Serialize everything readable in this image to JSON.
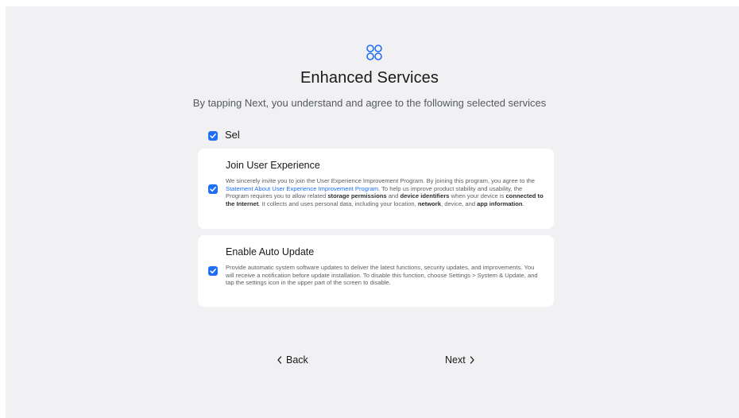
{
  "header": {
    "icon": "grid-four-circles-icon",
    "title": "Enhanced Services",
    "subtitle": "By tapping Next, you understand and agree to the following selected services"
  },
  "select_all": {
    "label": "Sel",
    "checked": true
  },
  "services": [
    {
      "title": "Join User Experience",
      "checked": true,
      "body": {
        "t1": "We sincerely invite you to join the User Experience Improvement Program. By joining this program, you agree to the ",
        "link": "Statement About User Experience Improvement Program",
        "t2": ". To help us improve product stability and usability, the Program requires you to allow related ",
        "b1": "storage permissions",
        "t3": " and ",
        "b2": "device identifiers",
        "t4": " when your device is ",
        "b3": "connected to the Internet",
        "t5": ". It collects and uses personal data, including your location, ",
        "b4": "network",
        "t6": ", device, and ",
        "b5": "app information",
        "t7": "."
      }
    },
    {
      "title": "Enable Auto Update",
      "checked": true,
      "body": "Provide automatic system software updates to deliver the latest functions, security updates, and improvements. You will receive a notification before update installation. To disable this function, choose Settings > System & Update, and tap the settings icon in the upper part of the screen to disable."
    }
  ],
  "footer": {
    "back_label": "Back",
    "next_label": "Next",
    "back_icon": "chevron-left-icon",
    "next_icon": "chevron-right-icon"
  },
  "colors": {
    "accent": "#1f6ff5",
    "background": "#f1f1f3",
    "card": "#ffffff",
    "text_primary": "#191919",
    "text_secondary": "#5a5e63"
  }
}
